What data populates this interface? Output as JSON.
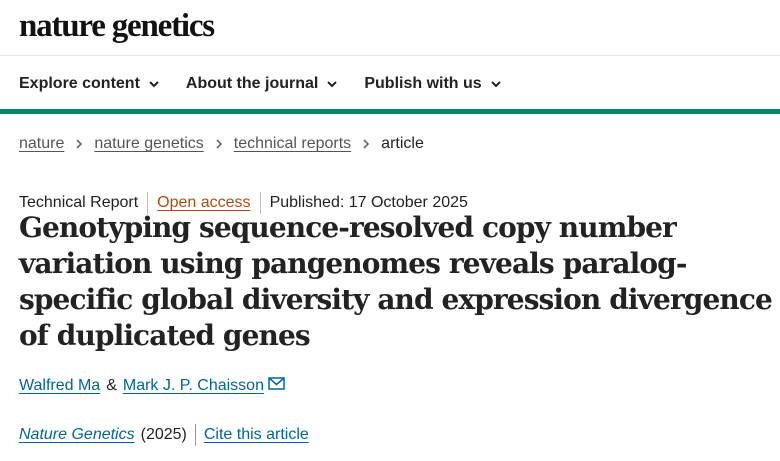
{
  "site": {
    "logo": "nature genetics"
  },
  "nav": {
    "items": [
      {
        "label": "Explore content",
        "icon": "chevron-down-icon"
      },
      {
        "label": "About the journal",
        "icon": "chevron-down-icon"
      },
      {
        "label": "Publish with us",
        "icon": "chevron-down-icon"
      }
    ]
  },
  "breadcrumb": {
    "items": [
      "nature",
      "nature genetics",
      "technical reports"
    ],
    "current": "article"
  },
  "article": {
    "type": "Technical Report",
    "access": "Open access",
    "published": "Published: 17 October 2025",
    "title": "Genotyping sequence-resolved copy number variation using pangenomes reveals paralog-specific global diversity and expression divergence of duplicated genes",
    "authors": [
      "Walfred Ma",
      "Mark J. P. Chaisson"
    ],
    "author_separator": "&",
    "journal": "Nature Genetics",
    "year": "(2025)",
    "cite_label": "Cite this article"
  },
  "colors": {
    "accent_bar": "#00856f",
    "link": "#006699",
    "open_access": "#b04a10"
  }
}
